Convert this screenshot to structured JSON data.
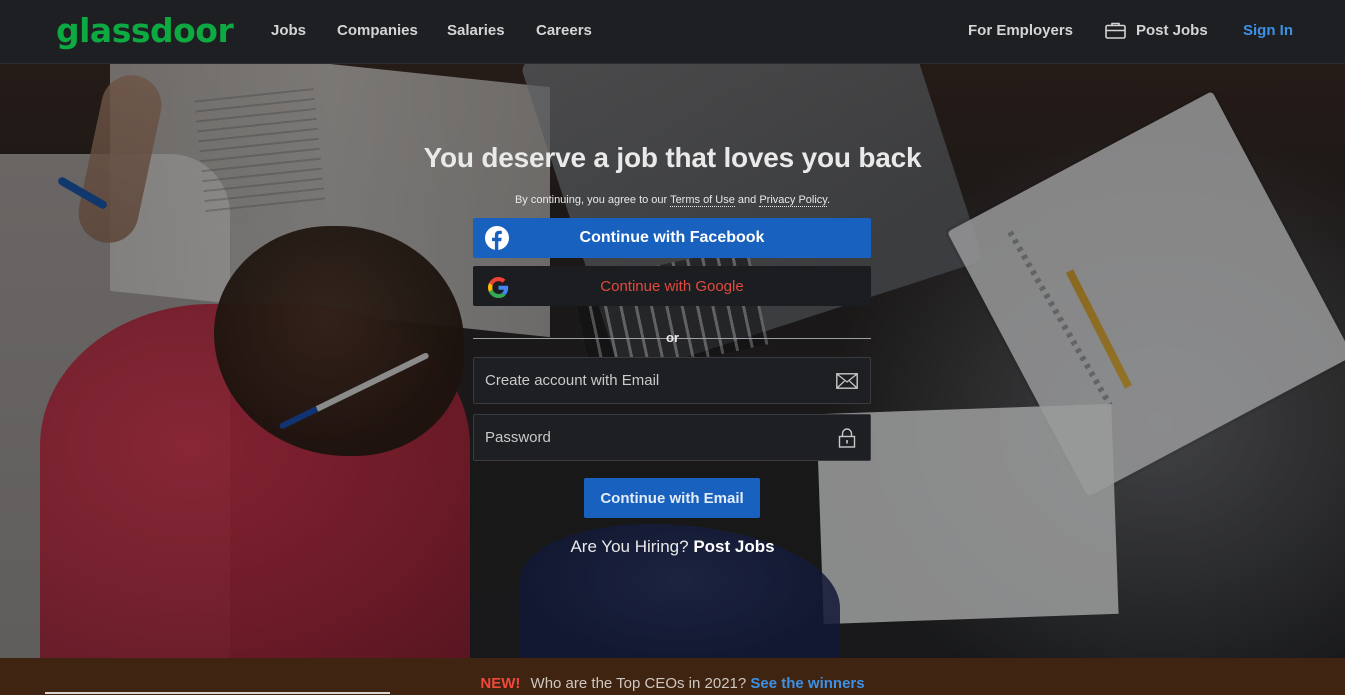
{
  "header": {
    "logo": "glassdoor",
    "nav": {
      "jobs": "Jobs",
      "companies": "Companies",
      "salaries": "Salaries",
      "careers": "Careers"
    },
    "for_employers": "For Employers",
    "post_jobs": "Post Jobs",
    "sign_in": "Sign In"
  },
  "hero": {
    "headline": "You deserve a job that loves you back",
    "terms_prefix": "By continuing, you agree to our",
    "terms_link": "Terms of Use",
    "terms_and": "and",
    "privacy_link": "Privacy Policy",
    "terms_suffix": "."
  },
  "auth": {
    "facebook_label": "Continue with Facebook",
    "google_label": "Continue with Google",
    "or": "or",
    "email_placeholder": "Create account with Email",
    "password_placeholder": "Password",
    "email_button": "Continue with Email",
    "hiring_prefix": "Are You Hiring?",
    "hiring_link": "Post Jobs"
  },
  "banner": {
    "new": "NEW!",
    "text": "Who are the Top CEOs in 2021?",
    "cta": "See the winners"
  },
  "colors": {
    "brand_green": "#0caa41",
    "accent_blue": "#1861bf",
    "link_blue": "#3d91e6",
    "google_red": "#e04a3f"
  },
  "icons": [
    "briefcase-icon",
    "facebook-icon",
    "google-icon",
    "mail-icon",
    "lock-icon"
  ]
}
